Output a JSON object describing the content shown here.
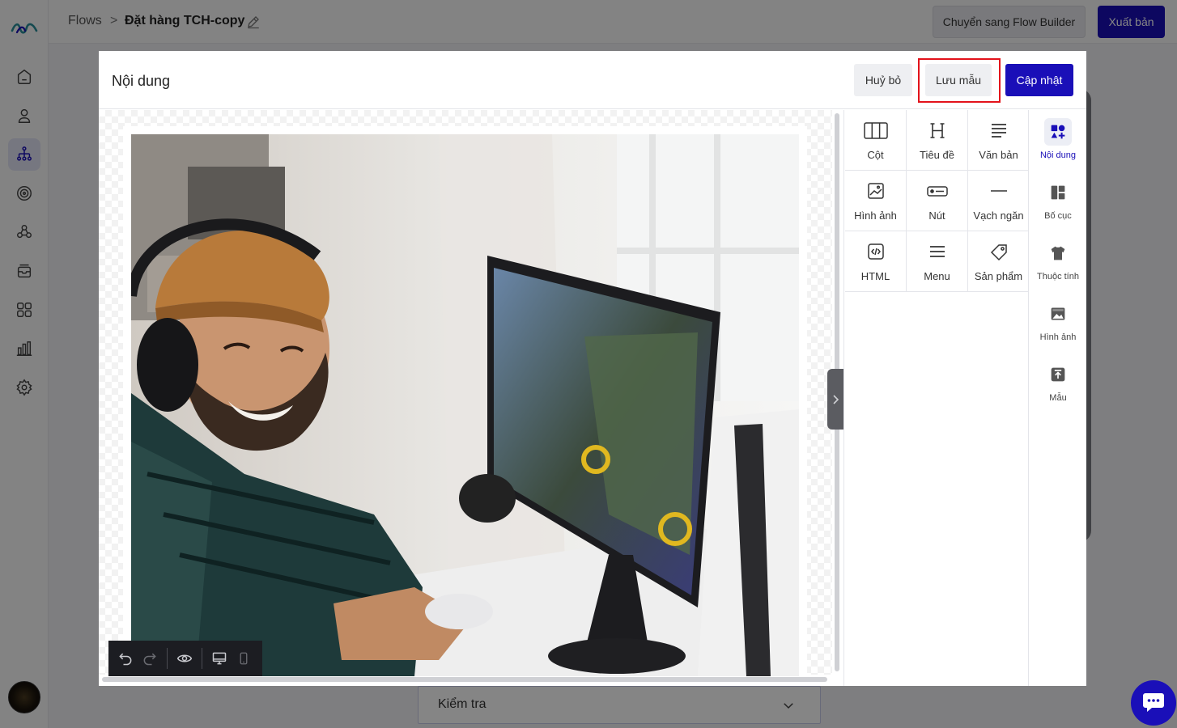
{
  "app": {
    "breadcrumb_root": "Flows",
    "breadcrumb_separator": ">",
    "flow_title": "Đặt hàng TCH-copy",
    "switch_button": "Chuyển sang Flow Builder",
    "publish_button": "Xuất bản",
    "dropdown_label": "Kiểm tra",
    "sidebar_icons": [
      "home-icon",
      "user-icon",
      "flow-tree-icon",
      "broadcast-icon",
      "segments-icon",
      "inbox-icon",
      "apps-icon",
      "analytics-icon",
      "settings-icon"
    ],
    "accent_color": "#1a0fb8"
  },
  "modal": {
    "title": "Nội dung",
    "cancel_button": "Huỷ bỏ",
    "save_template_button": "Lưu mẫu",
    "update_button": "Cập nhật"
  },
  "blocks": [
    {
      "label": "Cột",
      "icon": "columns-icon"
    },
    {
      "label": "Tiêu đề",
      "icon": "heading-icon"
    },
    {
      "label": "Văn bản",
      "icon": "text-icon"
    },
    {
      "label": "Hình ảnh",
      "icon": "image-icon"
    },
    {
      "label": "Nút",
      "icon": "button-icon"
    },
    {
      "label": "Vạch ngăn",
      "icon": "divider-icon"
    },
    {
      "label": "HTML",
      "icon": "html-icon"
    },
    {
      "label": "Menu",
      "icon": "menu-icon"
    },
    {
      "label": "Sản phẩm",
      "icon": "product-tag-icon"
    }
  ],
  "tabs": [
    {
      "label": "Nội dung",
      "icon": "content-icon",
      "active": true
    },
    {
      "label": "Bố cục",
      "icon": "layout-icon",
      "active": false
    },
    {
      "label": "Thuộc tính",
      "icon": "shirt-icon",
      "active": false
    },
    {
      "label": "Hình ảnh",
      "icon": "images-icon",
      "active": false
    },
    {
      "label": "Mẫu",
      "icon": "template-icon",
      "active": false
    }
  ],
  "toolbar": [
    "undo-icon",
    "redo-icon",
    "preview-eye-icon",
    "desktop-view-icon",
    "mobile-view-icon"
  ]
}
